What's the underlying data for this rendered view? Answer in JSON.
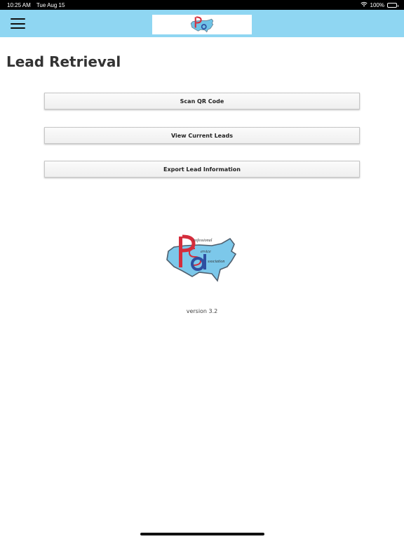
{
  "status_bar": {
    "time": "10:25 AM",
    "date": "Tue Aug 15",
    "battery_percent": "100%",
    "icons": [
      "wifi-icon",
      "battery-icon"
    ]
  },
  "navbar": {
    "menu_icon": "hamburger-menu-icon",
    "logo": "psa-logo",
    "background": "#8fd6f2"
  },
  "page": {
    "title": "Lead Retrieval"
  },
  "actions": {
    "scan_label": "Scan QR Code",
    "view_label": "View Current Leads",
    "export_label": "Export Lead Information"
  },
  "logo": {
    "line1": "rofessional",
    "line2": "ervice",
    "line3": "ssociation"
  },
  "footer": {
    "version": "version 3.2"
  }
}
